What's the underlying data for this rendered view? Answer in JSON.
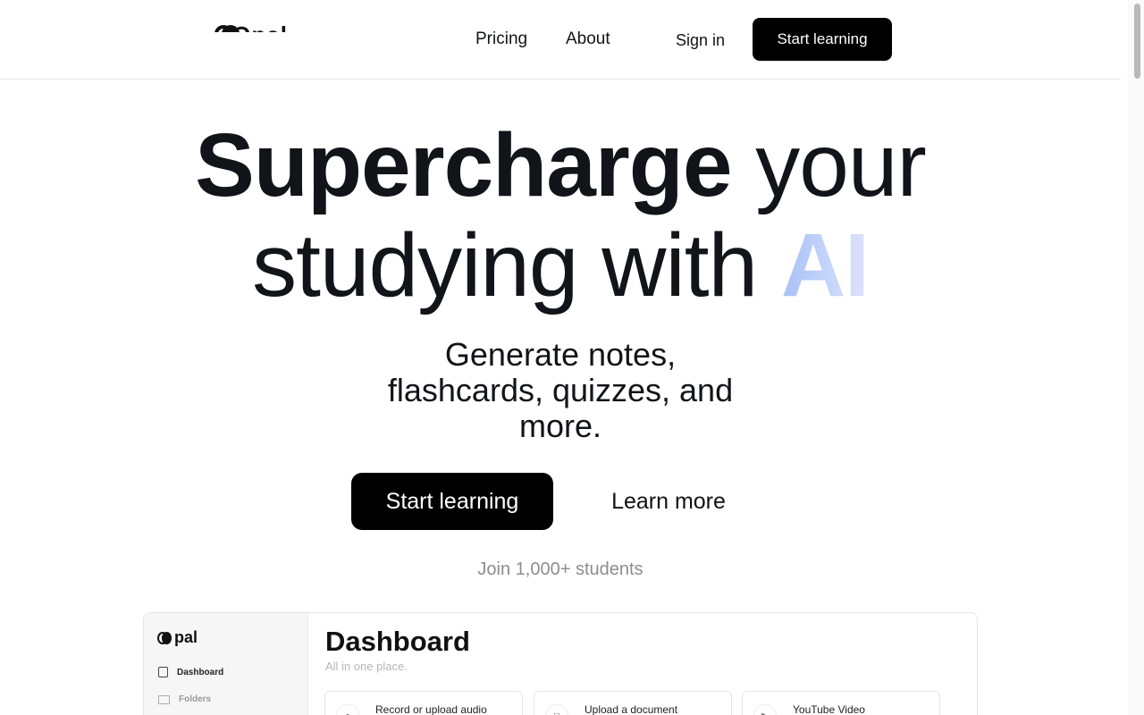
{
  "header": {
    "logo_text": "Opal",
    "nav": {
      "pricing": "Pricing",
      "about": "About",
      "sign_in": "Sign in",
      "cta": "Start learning"
    }
  },
  "hero": {
    "line1_bold": "Supercharge",
    "line1_rest": " your",
    "line2_rest": "studying with ",
    "line2_ai": "AI",
    "subtitle": "Generate notes, flashcards, quizzes, and more.",
    "primary_button": "Start learning",
    "secondary_button": "Learn more",
    "social_proof": "Join 1,000+ students"
  },
  "preview": {
    "logo_text": "pal",
    "sidebar": {
      "items": [
        {
          "label": "Dashboard",
          "icon": "document-icon"
        },
        {
          "label": "Folders",
          "icon": "folder-icon"
        }
      ]
    },
    "title": "Dashboard",
    "subtitle": "All in one place.",
    "cards": [
      {
        "label": "Record or upload audio",
        "icon": "microphone-icon"
      },
      {
        "label": "Upload a document",
        "icon": "document-icon"
      },
      {
        "label": "YouTube Video",
        "icon": "video-icon"
      }
    ]
  },
  "colors": {
    "primary": "#000000",
    "text": "#111418",
    "muted": "#8d8d8d",
    "ai_gradient_start": "#a9c1f6",
    "ai_gradient_end": "#dfe2fb"
  }
}
